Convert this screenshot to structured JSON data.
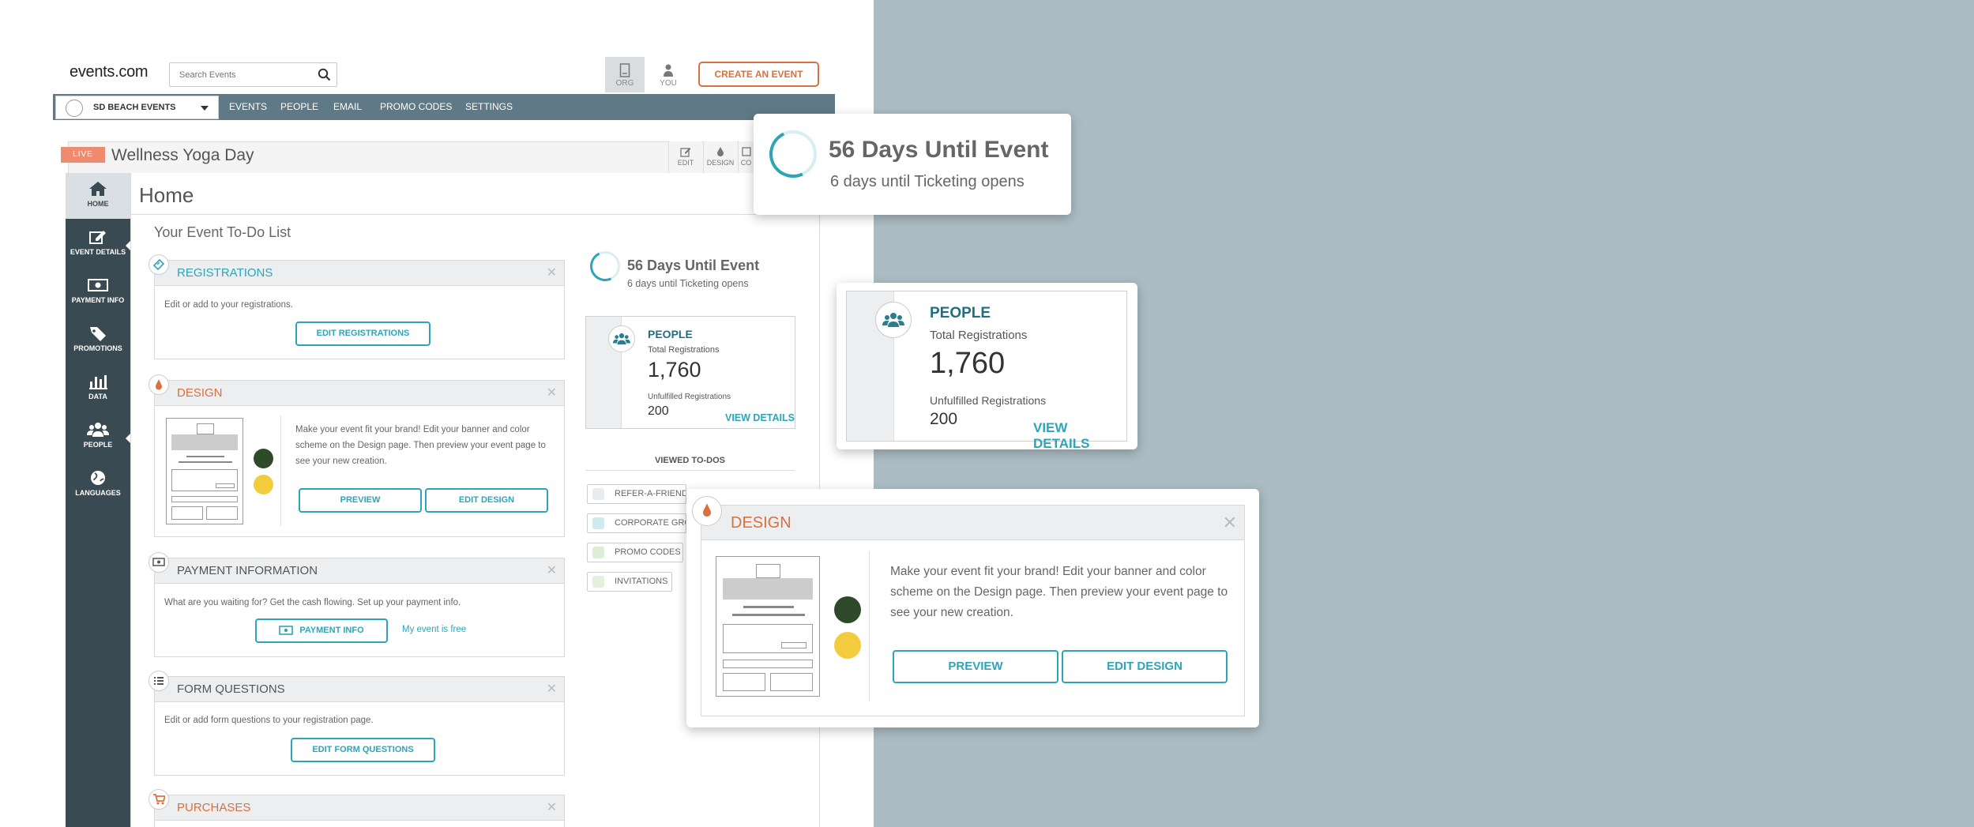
{
  "header": {
    "logo": "events.com",
    "search_placeholder": "Search Events",
    "org_label": "ORG",
    "you_label": "YOU",
    "create_label": "CREATE AN EVENT"
  },
  "nav": {
    "org_name": "SD BEACH EVENTS",
    "items": [
      "EVENTS",
      "PEOPLE",
      "EMAIL",
      "PROMO CODES",
      "SETTINGS"
    ]
  },
  "event": {
    "status": "LIVE",
    "title": "Wellness Yoga Day",
    "tools": [
      "EDIT",
      "DESIGN",
      "CO"
    ]
  },
  "sidebar": {
    "items": [
      "HOME",
      "EVENT DETAILS",
      "PAYMENT INFO",
      "PROMOTIONS",
      "DATA",
      "PEOPLE",
      "LANGUAGES"
    ]
  },
  "page": {
    "title": "Home",
    "todo_heading": "Your Event To-Do List"
  },
  "todos": {
    "registrations": {
      "title": "REGISTRATIONS",
      "text": "Edit or add to your registrations.",
      "button": "EDIT REGISTRATIONS"
    },
    "design": {
      "title": "DESIGN",
      "text": "Make your event fit your brand! Edit your banner and color scheme on the Design page. Then preview your event page to see your new creation.",
      "preview": "PREVIEW",
      "edit": "EDIT DESIGN",
      "color1": "#2f4a2a",
      "color2": "#f3cc3e"
    },
    "payment": {
      "title": "PAYMENT INFORMATION",
      "text": "What are you waiting for? Get the cash flowing. Set up your payment info.",
      "button": "PAYMENT INFO",
      "link": "My event is free"
    },
    "form": {
      "title": "FORM QUESTIONS",
      "text": "Edit or add form questions to your registration page.",
      "button": "EDIT FORM QUESTIONS"
    },
    "purchases": {
      "title": "PURCHASES"
    }
  },
  "countdown": {
    "title": "56 Days Until Event",
    "subtitle": "6 days until Ticketing opens"
  },
  "people": {
    "title": "PEOPLE",
    "total_label": "Total Registrations",
    "total_value": "1,760",
    "unfulfilled_label": "Unfulfilled Registrations",
    "unfulfilled_value": "200",
    "link": "VIEW DETAILS"
  },
  "viewed": {
    "heading": "VIEWED TO-DOS",
    "items": [
      "REFER-A-FRIEND",
      "CORPORATE GRO",
      "PROMO CODES",
      "INVITATIONS"
    ]
  },
  "colors": {
    "teal": "#2ea5b7",
    "orange": "#d9703f",
    "nav": "#5f7a86",
    "sidebar": "#3a4a52",
    "backdrop": "#acbcc4"
  }
}
